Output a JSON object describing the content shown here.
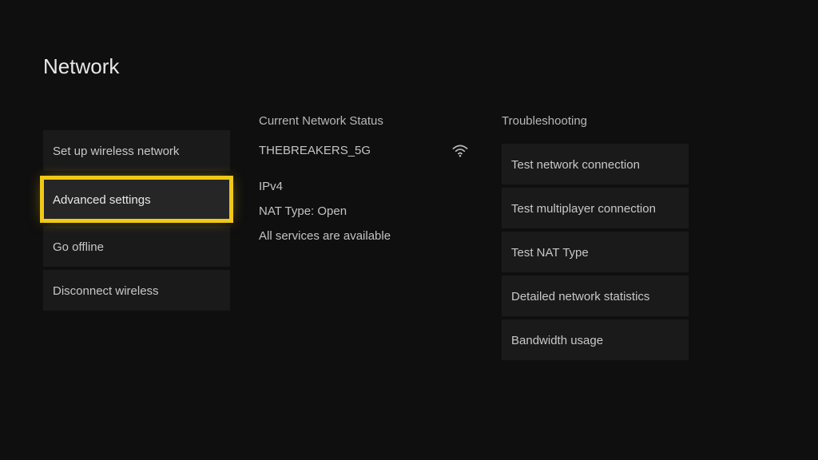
{
  "page_title": "Network",
  "left": {
    "items": [
      "Set up wireless network",
      "Advanced settings",
      "Go offline",
      "Disconnect wireless"
    ],
    "selected_index": 1
  },
  "status": {
    "header": "Current Network Status",
    "network_name": "THEBREAKERS_5G",
    "lines": [
      "IPv4",
      "NAT Type: Open",
      "All services are available"
    ]
  },
  "troubleshooting": {
    "header": "Troubleshooting",
    "items": [
      "Test network connection",
      "Test multiplayer connection",
      "Test NAT Type",
      "Detailed network statistics",
      "Bandwidth usage"
    ]
  }
}
